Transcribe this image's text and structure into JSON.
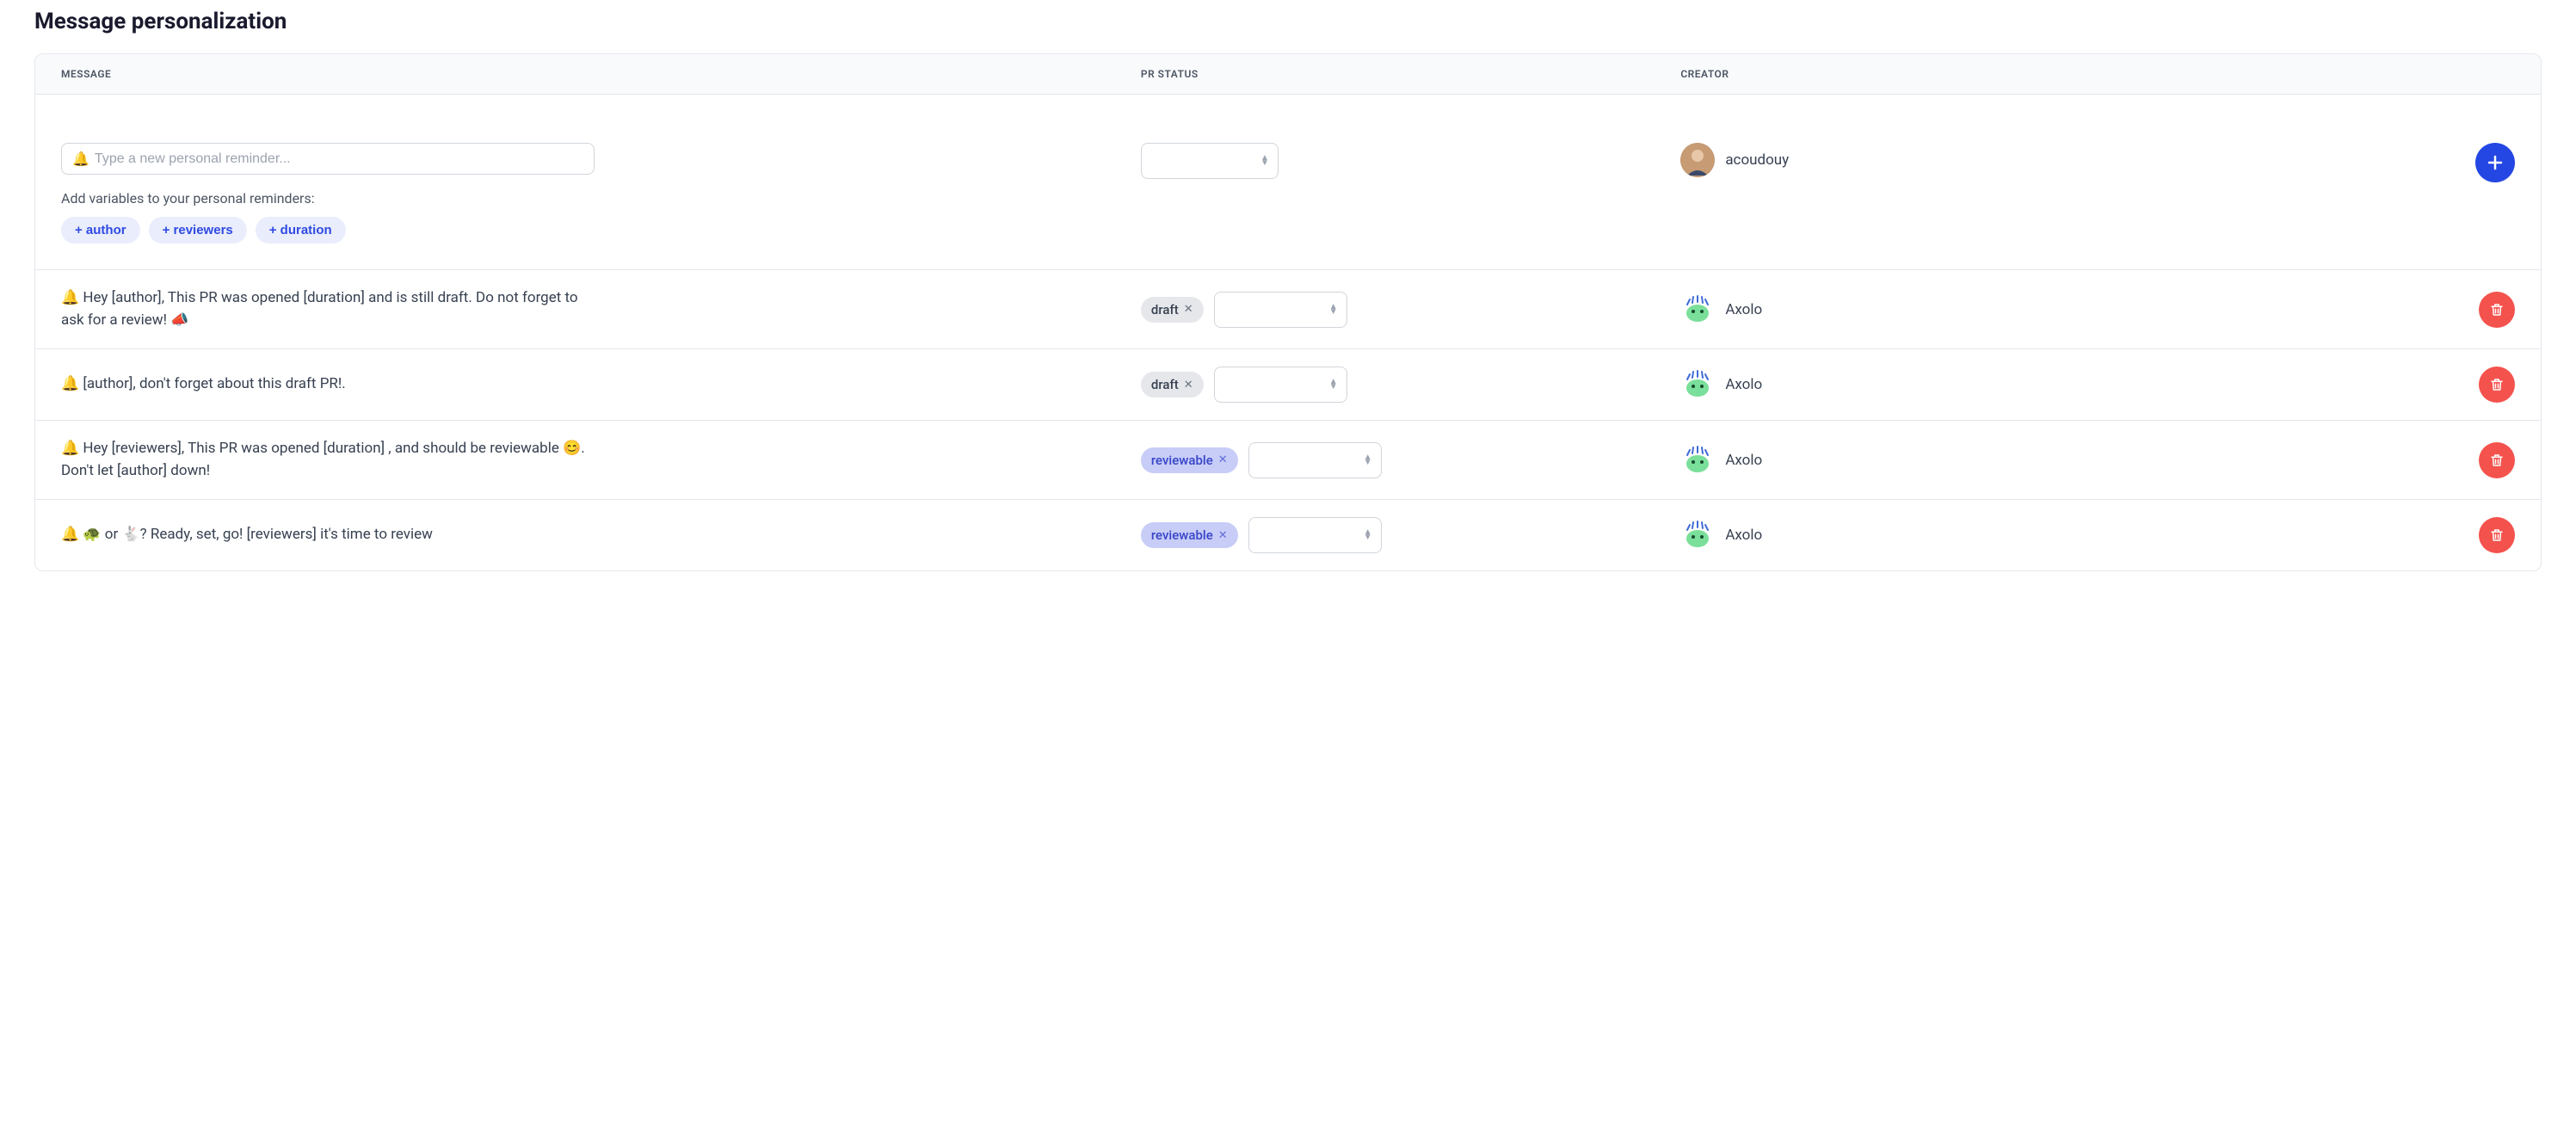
{
  "title": "Message personalization",
  "columns": {
    "message": "MESSAGE",
    "pr_status": "PR STATUS",
    "creator": "CREATOR"
  },
  "compose": {
    "placeholder": "Type a new personal reminder...",
    "helper": "Add variables to your personal reminders:",
    "vars": {
      "author": "+ author",
      "reviewers": "+ reviewers",
      "duration": "+ duration"
    },
    "creator": "acoudouy"
  },
  "rows": [
    {
      "message": "🔔 Hey [author], This PR was opened [duration] and is still draft. Do not forget to ask for a review! 📣",
      "status_tag": "draft",
      "status_kind": "draft",
      "creator": "Axolo"
    },
    {
      "message": "🔔 [author], don't forget about this draft PR!.",
      "status_tag": "draft",
      "status_kind": "draft",
      "creator": "Axolo"
    },
    {
      "message": "🔔 Hey [reviewers], This PR was opened [duration] , and should be reviewable 😊. Don't let [author] down!",
      "status_tag": "reviewable",
      "status_kind": "reviewable",
      "creator": "Axolo"
    },
    {
      "message": "🔔 🐢 or 🐇? Ready, set, go! [reviewers] it's time to review",
      "status_tag": "reviewable",
      "status_kind": "reviewable",
      "creator": "Axolo"
    }
  ]
}
